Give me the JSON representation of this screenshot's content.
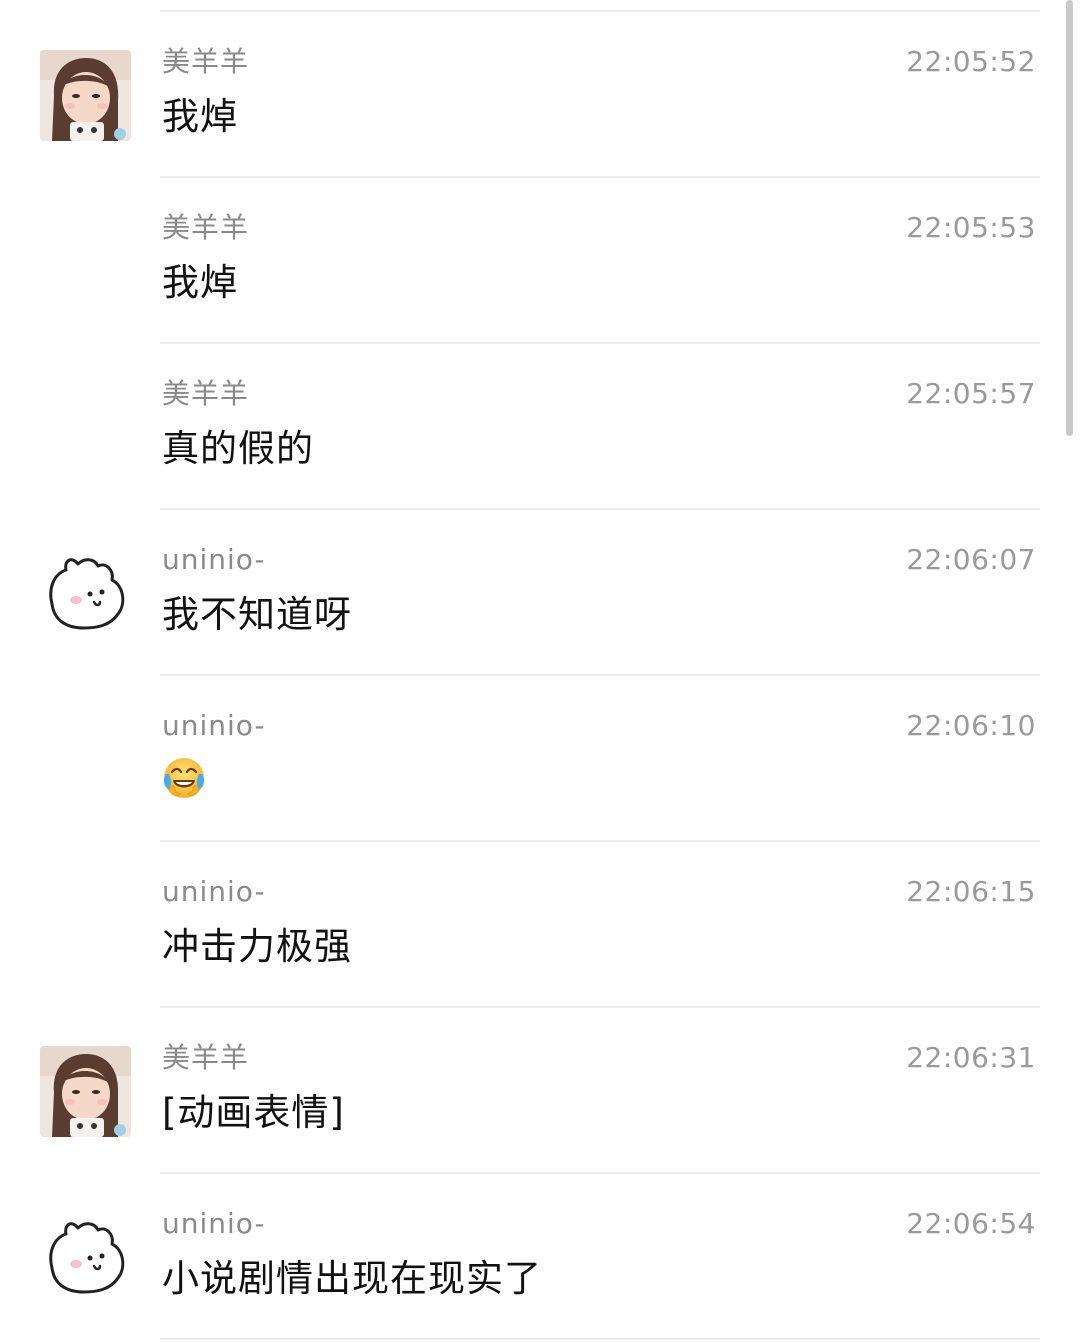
{
  "messages": [
    {
      "sender": "美羊羊",
      "time": "22:05:52",
      "text": "我焯",
      "avatar": "girl-photo",
      "show_avatar": true
    },
    {
      "sender": "美羊羊",
      "time": "22:05:53",
      "text": "我焯",
      "avatar": "girl-photo",
      "show_avatar": false
    },
    {
      "sender": "美羊羊",
      "time": "22:05:57",
      "text": "真的假的",
      "avatar": "girl-photo",
      "show_avatar": false
    },
    {
      "sender": "uninio-",
      "time": "22:06:07",
      "text": "我不知道呀",
      "avatar": "cartoon-bunny",
      "show_avatar": true
    },
    {
      "sender": "uninio-",
      "time": "22:06:10",
      "text": "",
      "emoji": "crying-laughing-face",
      "avatar": "cartoon-bunny",
      "show_avatar": false
    },
    {
      "sender": "uninio-",
      "time": "22:06:15",
      "text": "冲击力极强",
      "avatar": "cartoon-bunny",
      "show_avatar": false
    },
    {
      "sender": "美羊羊",
      "time": "22:06:31",
      "text": "[动画表情]",
      "avatar": "girl-photo",
      "show_avatar": true
    },
    {
      "sender": "uninio-",
      "time": "22:06:54",
      "text": "小说剧情出现在现实了",
      "avatar": "cartoon-bunny",
      "show_avatar": true
    }
  ],
  "colors": {
    "sender": "#8a8a8a",
    "time": "#9a9a9a",
    "text": "#111111",
    "divider": "#ececec",
    "scrollbar": "#c9c9c9"
  }
}
